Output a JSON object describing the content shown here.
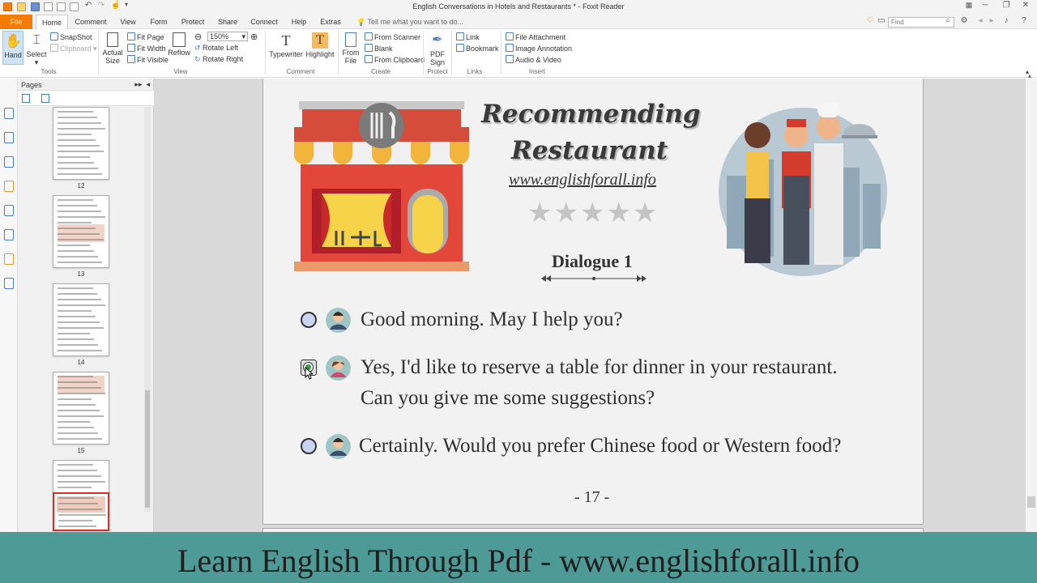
{
  "window": {
    "title": "English Conversations in Hotels and Restaurants * - Foxit Reader"
  },
  "tabs": {
    "file": "File",
    "home": "Home",
    "comment": "Comment",
    "view": "View",
    "form": "Form",
    "protect": "Protect",
    "share": "Share",
    "connect": "Connect",
    "help": "Help",
    "extras": "Extras",
    "tell_me": "Tell me what you want to do...",
    "find_placeholder": "Find"
  },
  "ribbon": {
    "hand": "Hand",
    "select": "Select",
    "snapshot": "SnapShot",
    "clipboard": "Clipboard",
    "actual_size_1": "Actual",
    "actual_size_2": "Size",
    "fit_page": "Fit Page",
    "fit_width": "Fit Width",
    "fit_visible": "Fit Visible",
    "reflow": "Reflow",
    "zoom_value": "150%",
    "rotate_left": "Rotate Left",
    "rotate_right": "Rotate Right",
    "typewriter": "Typewriter",
    "highlight": "Highlight",
    "from_file_1": "From",
    "from_file_2": "File",
    "from_scanner": "From Scanner",
    "blank": "Blank",
    "from_clipboard": "From Clipboard",
    "pdf_sign_1": "PDF",
    "pdf_sign_2": "Sign",
    "link": "Link",
    "bookmark": "Bookmark",
    "file_attachment": "File Attachment",
    "image_annotation": "Image Annotation",
    "audio_video": "Audio & Video",
    "groups": {
      "tools": "Tools",
      "view": "View",
      "comment": "Comment",
      "create": "Create",
      "protect": "Protect",
      "links": "Links",
      "insert": "Insert"
    }
  },
  "pages_panel": {
    "title": "Pages",
    "thumb_numbers": [
      "12",
      "13",
      "14",
      "15"
    ]
  },
  "document": {
    "title_line1": "Recommending",
    "title_line2": "Restaurant",
    "website": "www.englishforall.info",
    "stars": "★★★★★",
    "dialogue_title": "Dialogue 1",
    "lines": [
      "Good morning. May I help you?",
      "Yes, I'd like to reserve a table for dinner in your restaurant.",
      "Can you give me some suggestions?",
      "Certainly. Would you prefer Chinese food or Western food?"
    ],
    "page_number": "- 17 -"
  },
  "banner": {
    "text": "Learn English Through Pdf - www.englishforall.info"
  },
  "colors": {
    "file_tab": "#f57c00",
    "banner": "#4e9a97",
    "selected_thumb_border": "#d32f2f",
    "radio_fill": "#c9d3f2",
    "checked_dot": "#2e9e3a"
  }
}
